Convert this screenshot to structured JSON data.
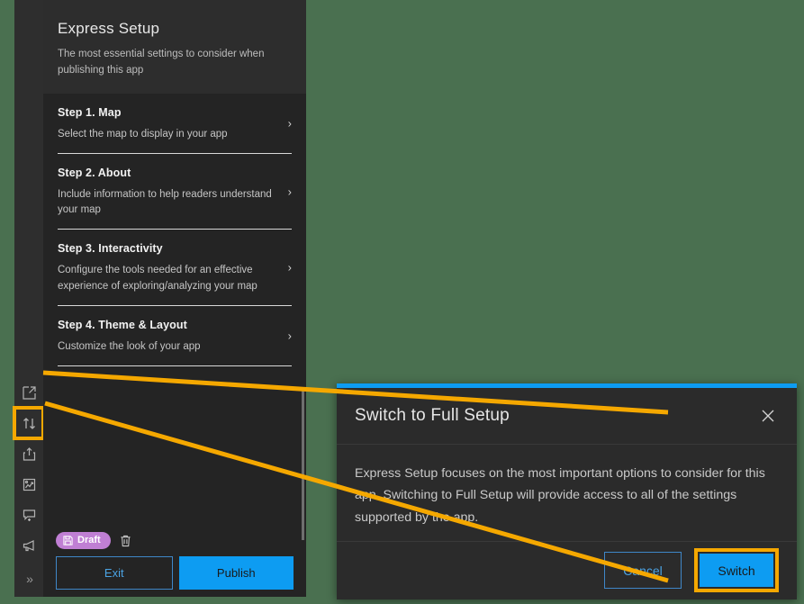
{
  "app": {
    "background_color": "#4a7050",
    "panel_background": "#242424",
    "accent_blue": "#0d9cf2",
    "highlight_yellow": "#f5a800",
    "draft_badge_color": "#c07fd4"
  },
  "rail": {
    "items": [
      {
        "name": "open-in-new-window-icon",
        "icon": "open-external",
        "highlighted": false
      },
      {
        "name": "switch-setup-mode-icon",
        "icon": "arrows-up-down",
        "highlighted": true
      },
      {
        "name": "share-icon",
        "icon": "share-export",
        "highlighted": false
      },
      {
        "name": "preview-icon",
        "icon": "image-preview",
        "highlighted": false
      },
      {
        "name": "feedback-icon",
        "icon": "comment-plus",
        "highlighted": false
      },
      {
        "name": "announcement-icon",
        "icon": "megaphone",
        "highlighted": false
      }
    ],
    "expand_label": "»"
  },
  "panel": {
    "title": "Express Setup",
    "subtitle": "The most essential settings to consider when publishing this app",
    "steps": [
      {
        "title": "Step 1. Map",
        "desc": "Select the map to display in your app",
        "chevron": "›"
      },
      {
        "title": "Step 2. About",
        "desc": "Include information to help readers understand your map",
        "chevron": "›"
      },
      {
        "title": "Step 3. Interactivity",
        "desc": "Configure the tools needed for an effective experience of exploring/analyzing your map",
        "chevron": "›"
      },
      {
        "title": "Step 4. Theme & Layout",
        "desc": "Customize the look of your app",
        "chevron": "›"
      }
    ],
    "status": {
      "draft_label": "Draft",
      "draft_icon": "save-disk-icon",
      "delete_icon": "trash-icon"
    },
    "actions": {
      "exit_label": "Exit",
      "publish_label": "Publish"
    }
  },
  "dialog": {
    "title": "Switch to Full Setup",
    "close_icon": "close-icon",
    "body": "Express Setup focuses on the most important options to consider for this app. Switching to Full Setup will provide access to all of the settings supported by the app.",
    "cancel_label": "Cancel",
    "switch_label": "Switch"
  }
}
